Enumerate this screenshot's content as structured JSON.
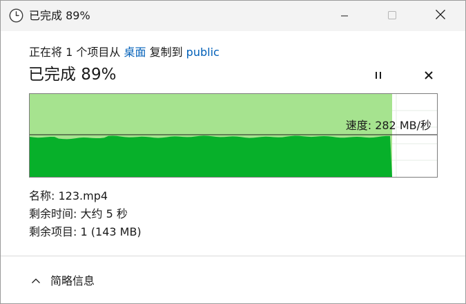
{
  "window": {
    "title": "已完成 89%",
    "icon": "clock-icon"
  },
  "caption_buttons": {
    "minimize_icon": "minimize-icon",
    "maximize_icon": "maximize-icon",
    "close_icon": "close-icon"
  },
  "copy": {
    "prefix": "正在将 1 个项目从",
    "source": "桌面",
    "middle": "复制到",
    "destination": "public"
  },
  "progress": {
    "headline": "已完成 89%",
    "percent": 89,
    "pause_icon": "pause-icon",
    "cancel_icon": "cancel-icon"
  },
  "graph": {
    "speed_text": "速度: 282 MB/秒",
    "fill_color": "#07b02a",
    "completed_color": "#a6e38f",
    "current_speed_line_color": "#1a1a1a"
  },
  "details": {
    "name_label": "名称:",
    "name_value": "123.mp4",
    "time_label": "剩余时间:",
    "time_value": "大约 5 秒",
    "items_label": "剩余项目:",
    "items_value": "1 (143 MB)"
  },
  "footer": {
    "less_info_label": "简略信息",
    "toggle_icon": "chevron-up-icon"
  }
}
